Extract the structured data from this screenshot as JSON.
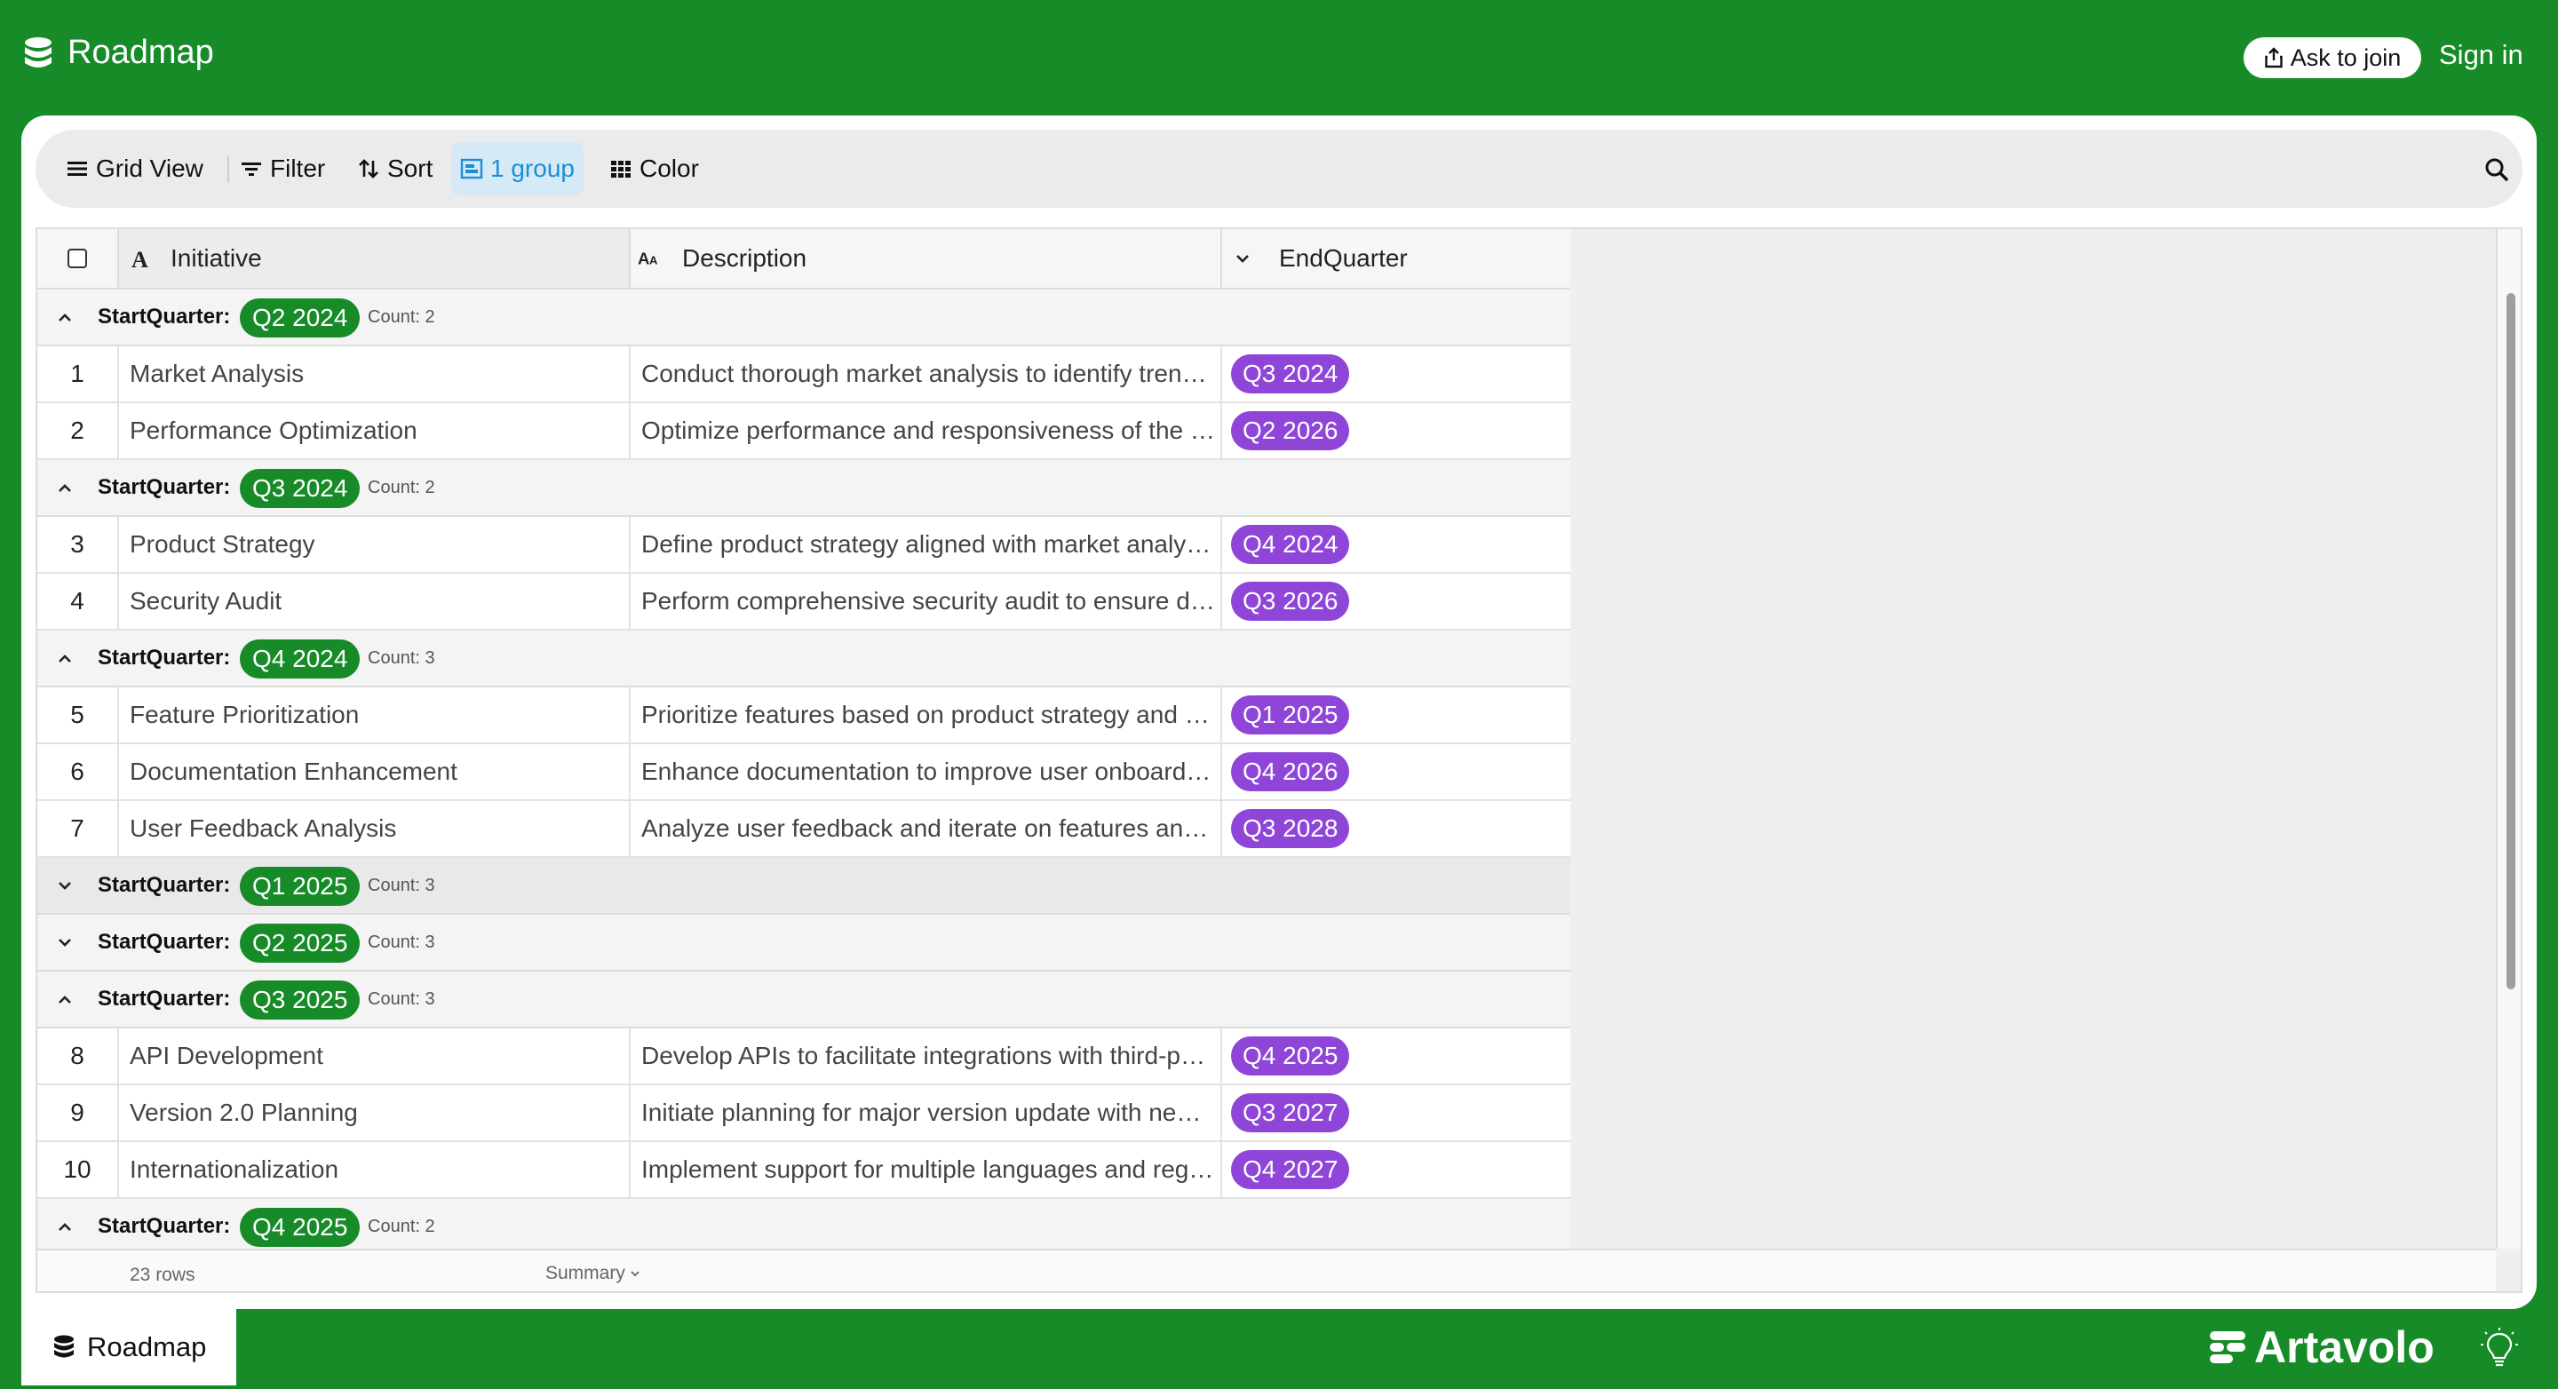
{
  "app": {
    "title": "Roadmap",
    "ask_to_join": "Ask to join",
    "sign_in": "Sign in"
  },
  "toolbar": {
    "grid_view": "Grid View",
    "filter": "Filter",
    "sort": "Sort",
    "group": "1 group",
    "color": "Color"
  },
  "columns": {
    "initiative": "Initiative",
    "description": "Description",
    "end_quarter": "EndQuarter"
  },
  "group_field_label": "StartQuarter:",
  "groups": [
    {
      "quarter": "Q2 2024",
      "count": "Count: 2",
      "expanded": true,
      "rows": [
        {
          "num": "1",
          "initiative": "Market Analysis",
          "description": "Conduct thorough market analysis to identify trends and opportunities",
          "end": "Q3 2024"
        },
        {
          "num": "2",
          "initiative": "Performance Optimization",
          "description": "Optimize performance and responsiveness of the application",
          "end": "Q2 2026"
        }
      ]
    },
    {
      "quarter": "Q3 2024",
      "count": "Count: 2",
      "expanded": true,
      "rows": [
        {
          "num": "3",
          "initiative": "Product Strategy",
          "description": "Define product strategy aligned with market analysis findings",
          "end": "Q4 2024"
        },
        {
          "num": "4",
          "initiative": "Security Audit",
          "description": "Perform comprehensive security audit to ensure data protection",
          "end": "Q3 2026"
        }
      ]
    },
    {
      "quarter": "Q4 2024",
      "count": "Count: 3",
      "expanded": true,
      "rows": [
        {
          "num": "5",
          "initiative": "Feature Prioritization",
          "description": "Prioritize features based on product strategy and user needs",
          "end": "Q1 2025"
        },
        {
          "num": "6",
          "initiative": "Documentation Enhancement",
          "description": "Enhance documentation to improve user onboarding experience",
          "end": "Q4 2026"
        },
        {
          "num": "7",
          "initiative": "User Feedback Analysis",
          "description": "Analyze user feedback and iterate on features and improvements",
          "end": "Q3 2028"
        }
      ]
    },
    {
      "quarter": "Q1 2025",
      "count": "Count: 3",
      "expanded": false,
      "rows": []
    },
    {
      "quarter": "Q2 2025",
      "count": "Count: 3",
      "expanded": false,
      "rows": []
    },
    {
      "quarter": "Q3 2025",
      "count": "Count: 3",
      "expanded": true,
      "rows": [
        {
          "num": "8",
          "initiative": "API Development",
          "description": "Develop APIs to facilitate integrations with third-party services",
          "end": "Q4 2025"
        },
        {
          "num": "9",
          "initiative": "Version 2.0 Planning",
          "description": "Initiate planning for major version update with new features",
          "end": "Q3 2027"
        },
        {
          "num": "10",
          "initiative": "Internationalization",
          "description": "Implement support for multiple languages and regions",
          "end": "Q4 2027"
        }
      ]
    },
    {
      "quarter": "Q4 2025",
      "count": "Count: 2",
      "expanded": true,
      "rows": []
    }
  ],
  "footer": {
    "row_count": "23 rows",
    "summary": "Summary"
  },
  "bottom": {
    "tab_label": "Roadmap",
    "logo_text": "Artavolo"
  },
  "colors": {
    "brand_green": "#168b27",
    "end_pill_purple": "#8e45d8",
    "group_accent_blue": "#1a8fd8"
  }
}
